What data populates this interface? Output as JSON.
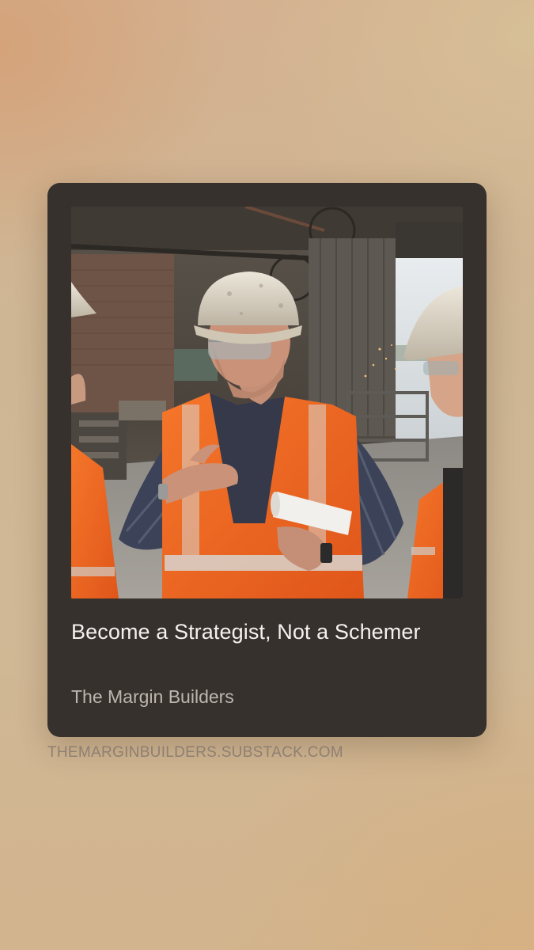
{
  "post": {
    "title": "Become a Strategist, Not a Schemer",
    "publication": "The Margin Builders",
    "image_alt": "Workers in hard hats and orange safety vests talking in a factory"
  },
  "footer": {
    "site_url": "THEMARGINBUILDERS.SUBSTACK.COM"
  },
  "colors": {
    "card_background": "#36312d",
    "title_text": "#f4f1ee",
    "publication_text": "#bdb6ae",
    "url_text": "#8e7f72",
    "vest_orange": "#f0641e"
  }
}
